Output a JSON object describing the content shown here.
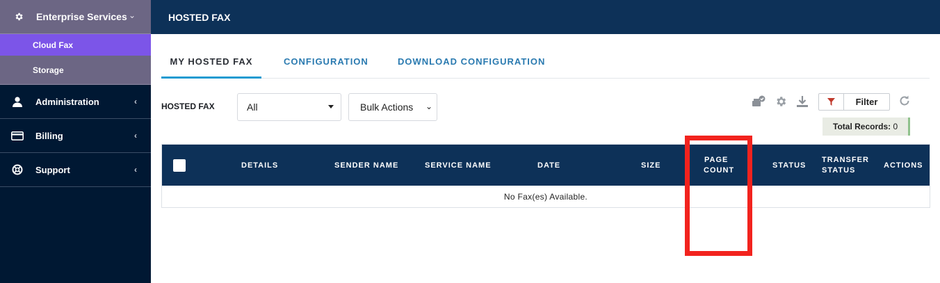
{
  "sidebar": {
    "section": {
      "label": "Enterprise Services",
      "icon": "gear-icon"
    },
    "sub_items": [
      {
        "label": "Cloud Fax",
        "active": true
      },
      {
        "label": "Storage",
        "active": false
      }
    ],
    "items": [
      {
        "label": "Administration",
        "icon": "user-icon"
      },
      {
        "label": "Billing",
        "icon": "credit-card-icon"
      },
      {
        "label": "Support",
        "icon": "lifebuoy-icon"
      }
    ]
  },
  "header": {
    "title": "HOSTED FAX"
  },
  "tabs": [
    {
      "label": "MY HOSTED FAX",
      "active": true
    },
    {
      "label": "CONFIGURATION",
      "active": false
    },
    {
      "label": "DOWNLOAD CONFIGURATION",
      "active": false
    }
  ],
  "toolbar": {
    "label": "HOSTED FAX",
    "filter_select": "All",
    "bulk_select": "Bulk Actions",
    "filter_button": "Filter",
    "records_label": "Total Records:",
    "records_count": "0"
  },
  "table": {
    "columns": [
      "DETAILS",
      "SENDER NAME",
      "SERVICE NAME",
      "DATE",
      "SIZE",
      "PAGE",
      "COUNT",
      "STATUS",
      "TRANSFER",
      "STATUS",
      "ACTIONS"
    ],
    "empty_message": "No Fax(es) Available."
  },
  "colors": {
    "sidebar_bg": "#001833",
    "header_bg": "#0d3158",
    "active_sub": "#7c55e8",
    "tab_link": "#2a7ab0",
    "highlight": "#f2231e"
  }
}
